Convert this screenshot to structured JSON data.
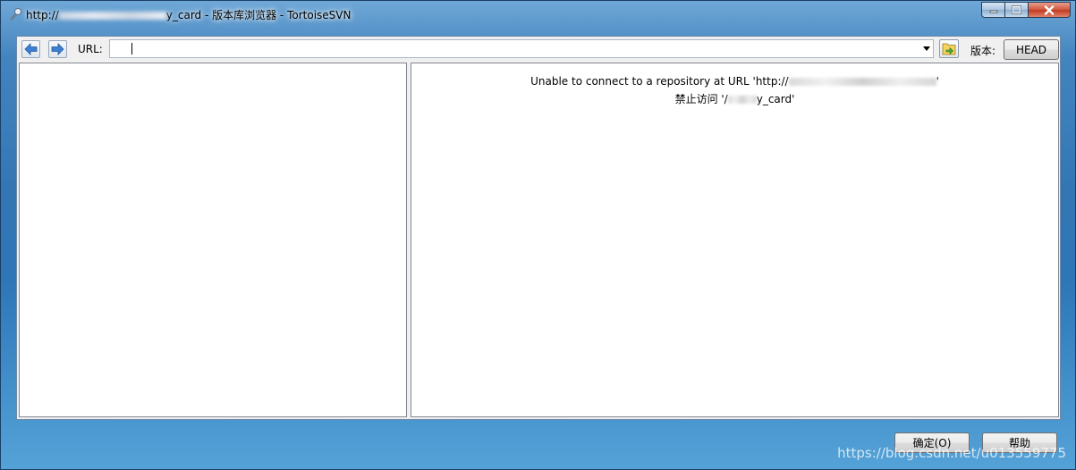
{
  "window": {
    "title_prefix": "http://",
    "title_suffix": "y_card - 版本库浏览器 - TortoiseSVN",
    "accent_color": "#4a8cc8"
  },
  "caption_buttons": {
    "minimize_icon": "minimize-icon",
    "maximize_icon": "maximize-icon",
    "close_icon": "close-icon"
  },
  "toolbar": {
    "back_icon": "back-arrow-icon",
    "forward_icon": "forward-arrow-icon",
    "url_label": "URL:",
    "url_value": "",
    "go_icon": "folder-go-icon",
    "revision_label": "版本:",
    "revision_button": "HEAD"
  },
  "right_pane": {
    "error_line1_prefix": "Unable to connect to a repository at URL 'http://",
    "error_line1_suffix": "'",
    "error_line2_prefix": "禁止访问 '/",
    "error_line2_suffix": "y_card'"
  },
  "buttons": {
    "ok_label": "确定(O)",
    "help_label": "帮助"
  },
  "watermark": "https://blog.csdn.net/u013559775"
}
